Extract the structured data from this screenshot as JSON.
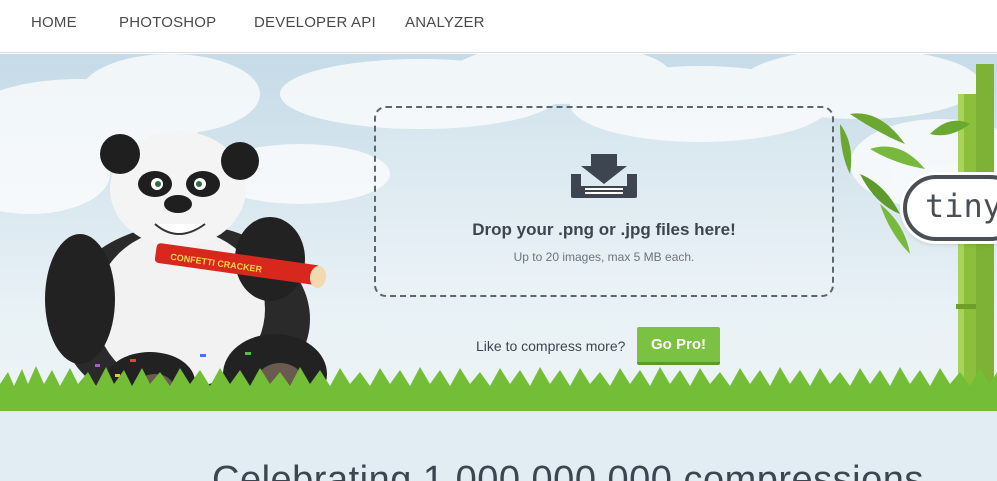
{
  "nav": {
    "items": [
      {
        "label": "HOME"
      },
      {
        "label": "PHOTOSHOP"
      },
      {
        "label": "DEVELOPER API"
      },
      {
        "label": "ANALYZER"
      }
    ]
  },
  "hero": {
    "dropzone": {
      "icon": "download-tray-icon",
      "title": "Drop your .png or .jpg files here!",
      "subtitle": "Up to 20 images, max 5 MB each."
    },
    "compress_prompt": "Like to compress more?",
    "gopro_label": "Go Pro!",
    "logo_text": "tiny",
    "mascot": "panda-mascot",
    "firecracker_text": "CONFETTI CRACKER"
  },
  "banner": {
    "celebrate_text": "Celebrating 1,000,000,000 compressions"
  },
  "colors": {
    "accent_green": "#7cc242",
    "text_dark": "#3d4650",
    "lower_band": "#e1edf3",
    "nav_border": "#d9dde1"
  }
}
